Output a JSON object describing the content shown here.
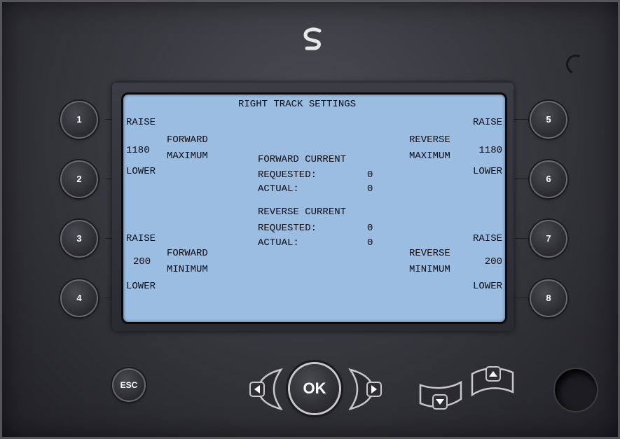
{
  "screen": {
    "title": "RIGHT TRACK SETTINGS",
    "left_top": {
      "raise": "RAISE",
      "value": "1180",
      "label1": "FORWARD",
      "label2": "MAXIMUM",
      "lower": "LOWER"
    },
    "left_bottom": {
      "raise": "RAISE",
      "value": "200",
      "label1": "FORWARD",
      "label2": "MINIMUM",
      "lower": "LOWER"
    },
    "right_top": {
      "raise": "RAISE",
      "value": "1180",
      "label1": "REVERSE",
      "label2": "MAXIMUM",
      "lower": "LOWER"
    },
    "right_bottom": {
      "raise": "RAISE",
      "value": "200",
      "label1": "REVERSE",
      "label2": "MINIMUM",
      "lower": "LOWER"
    },
    "forward_current": {
      "heading": "FORWARD CURRENT",
      "requested_label": "REQUESTED:",
      "requested_value": "0",
      "actual_label": "ACTUAL:",
      "actual_value": "0"
    },
    "reverse_current": {
      "heading": "REVERSE CURRENT",
      "requested_label": "REQUESTED:",
      "requested_value": "0",
      "actual_label": "ACTUAL:",
      "actual_value": "0"
    }
  },
  "softkeys": [
    "1",
    "2",
    "3",
    "4",
    "5",
    "6",
    "7",
    "8"
  ],
  "buttons": {
    "esc": "ESC",
    "ok": "OK"
  },
  "icons": {
    "logo": "s-logo-icon",
    "left": "chevron-left-icon",
    "right": "chevron-right-icon",
    "down": "chevron-down-icon",
    "up": "chevron-up-icon"
  },
  "colors": {
    "screen_bg": "#9bbde2",
    "text": "#0c0c14",
    "housing": "#34343b"
  }
}
